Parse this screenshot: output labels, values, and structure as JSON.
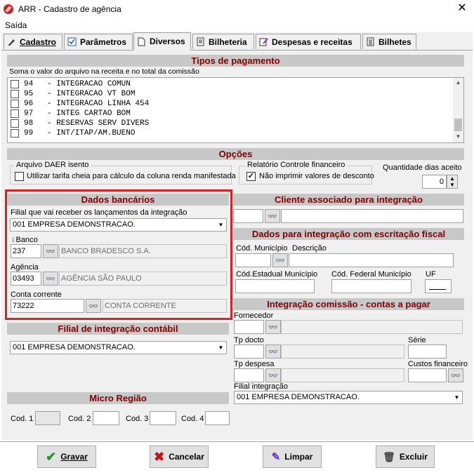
{
  "window": {
    "title": "ARR - Cadastro de agência"
  },
  "menu": {
    "saida": "Saída"
  },
  "tabs": [
    {
      "label": "Cadastro",
      "icon": "pencil-icon"
    },
    {
      "label": "Parâmetros",
      "icon": "checkbox-icon"
    },
    {
      "label": "Diversos",
      "icon": "document-icon"
    },
    {
      "label": "Bilheteria",
      "icon": "sheet-icon"
    },
    {
      "label": "Despesas e receitas",
      "icon": "edit-doc-icon"
    },
    {
      "label": "Bilhetes",
      "icon": "ticket-icon"
    }
  ],
  "active_tab": "Diversos",
  "tipos_pagamento": {
    "header": "Tipos de pagamento",
    "note": "Soma o valor do arquivo na receita e no total da comissão",
    "items": [
      {
        "text": "94   - INTEGRACAO COMUN"
      },
      {
        "text": "95   - INTEGRACAO VT BOM"
      },
      {
        "text": "96   - INTEGRACAO LINHA 454"
      },
      {
        "text": "97   - INTEG CARTAO BOM"
      },
      {
        "text": "98   - RESERVAS SERV DIVERS"
      },
      {
        "text": "99   - INT/ITAP/AM.BUENO"
      }
    ]
  },
  "opcoes": {
    "header": "Opções",
    "arquivo_group": "Arquivo DAER isento",
    "arquivo_check": "Utilizar tarifa cheia para cálculo da coluna renda  manifestada",
    "relatorio_group": "Relatório Controle financeiro",
    "relatorio_check": "Não imprimir valores de desconto",
    "quantidade_label": "Quantidade dias aceito",
    "quantidade_value": "0"
  },
  "dados_bancarios": {
    "header": "Dados bancários",
    "filial_label": "Filial que vai receber os lançamentos da integração",
    "filial_value": "001 EMPRESA DEMONSTRACAO.",
    "banco_label": "Banco",
    "banco_code": "237",
    "banco_name": "BANCO BRADESCO S.A.",
    "agencia_label": "Agência",
    "agencia_code": "03493",
    "agencia_name": "AGÊNCIA SÃO PAULO",
    "conta_label": "Conta corrente",
    "conta_code": "73222",
    "conta_name": "CONTA CORRENTE"
  },
  "filial_contabil": {
    "header": "Filial de integração contábil",
    "value": "001 EMPRESA DEMONSTRACAO."
  },
  "micro_regiao": {
    "header": "Micro Região",
    "cod1": "Cod. 1",
    "cod2": "Cod. 2",
    "cod3": "Cod. 3",
    "cod4": "Cod. 4"
  },
  "cliente": {
    "header": "Cliente associado para integração"
  },
  "fiscal": {
    "header": "Dados para integração com escritação fiscal",
    "cod_municipio": "Cód. Município",
    "descricao": "Descrição",
    "cod_estadual": "Cód.Estadual Município",
    "cod_federal": "Cód. Federal Município",
    "uf": "UF"
  },
  "comissao": {
    "header": "Integração comissão - contas a pagar",
    "fornecedor": "Fornecedor",
    "tp_docto": "Tp docto",
    "serie": "Série",
    "tp_despesa": "Tp despesa",
    "custos": "Custos financeiro",
    "filial_label": "Filial integração",
    "filial_value": "001 EMPRESA DEMONSTRACAO."
  },
  "buttons": {
    "gravar": "Gravar",
    "cancelar": "Cancelar",
    "limpar": "Limpar",
    "excluir": "Excluir"
  }
}
